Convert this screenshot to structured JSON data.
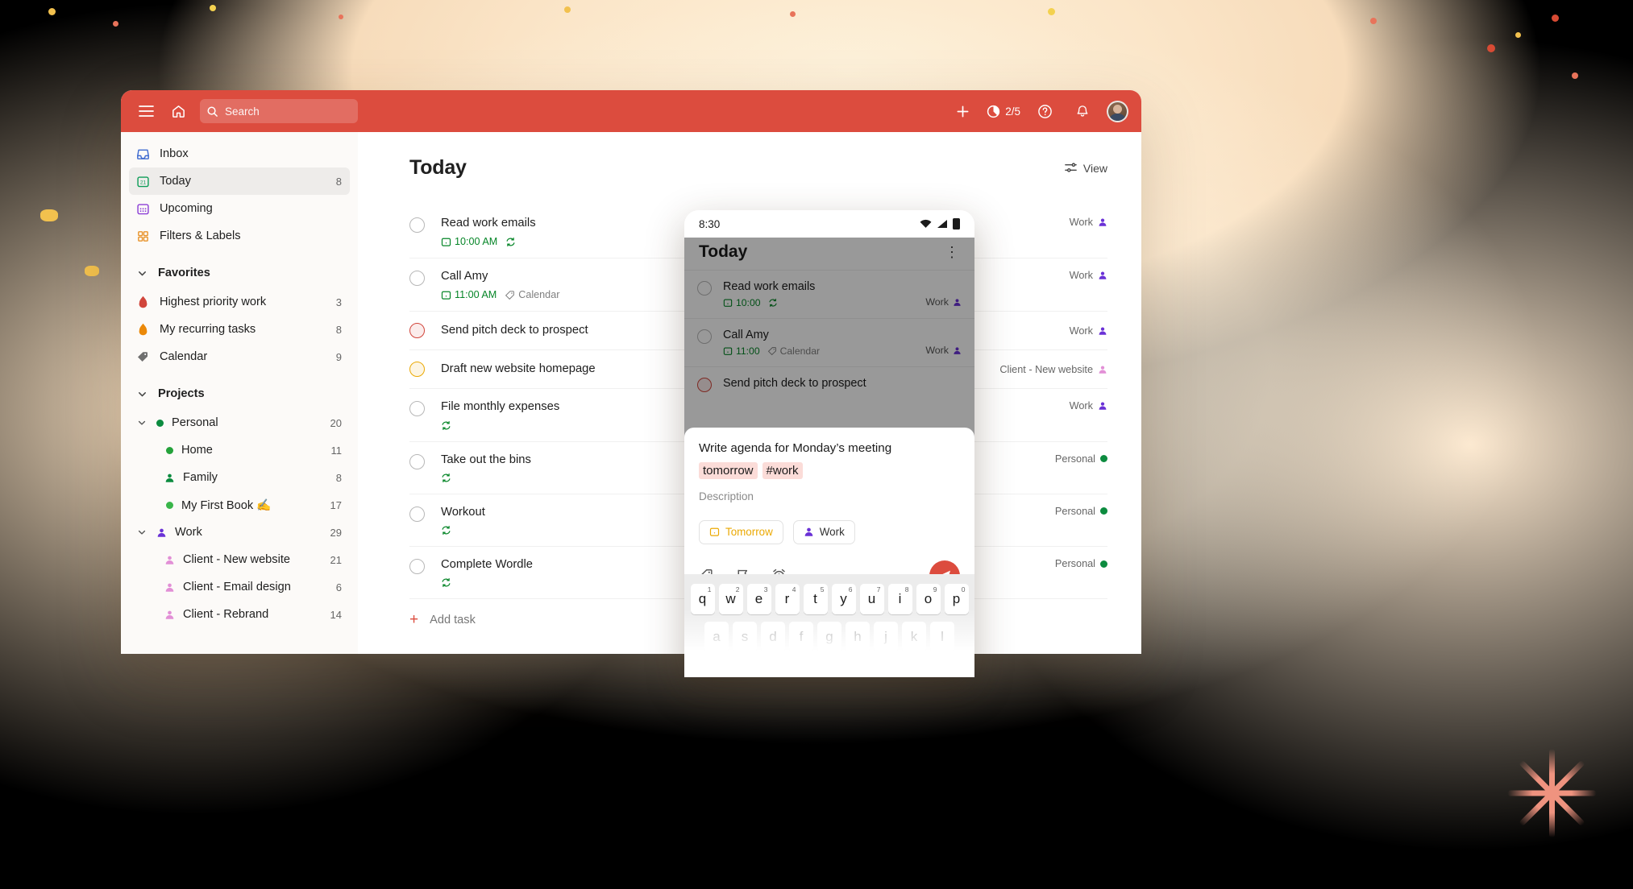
{
  "topbar": {
    "menu_icon": "hamburger-menu-icon",
    "home_icon": "home-icon",
    "search_icon": "search-icon",
    "search_placeholder": "Search",
    "add_icon": "plus-icon",
    "productivity_value": "2/5",
    "help_icon": "question-mark-icon",
    "notifications_icon": "bell-icon",
    "avatar": "user-avatar"
  },
  "sidebar": {
    "nav": [
      {
        "label": "Inbox",
        "icon": "inbox-icon",
        "count": "",
        "active": false
      },
      {
        "label": "Today",
        "icon": "calendar-today-icon",
        "count": "8",
        "active": true
      },
      {
        "label": "Upcoming",
        "icon": "calendar-month-icon",
        "count": "",
        "active": false
      },
      {
        "label": "Filters & Labels",
        "icon": "filters-labels-icon",
        "count": "",
        "active": false
      }
    ],
    "favorites": {
      "title": "Favorites",
      "items": [
        {
          "label": "Highest priority work",
          "icon": "flame-red-icon",
          "count": "3"
        },
        {
          "label": "My recurring tasks",
          "icon": "flame-orange-icon",
          "count": "8"
        },
        {
          "label": "Calendar",
          "icon": "tag-grey-icon",
          "count": "9"
        }
      ]
    },
    "projects": {
      "title": "Projects",
      "items": [
        {
          "label": "Personal",
          "icon": "dot-green",
          "count": "20",
          "level": 0,
          "expandable": true
        },
        {
          "label": "Home",
          "icon": "dot-lightgreen",
          "count": "11",
          "level": 1,
          "expandable": false
        },
        {
          "label": "Family",
          "icon": "person-green",
          "count": "8",
          "level": 1,
          "expandable": false
        },
        {
          "label": "My First Book ✍️",
          "icon": "dot-lightgreen",
          "count": "17",
          "level": 1,
          "expandable": false
        },
        {
          "label": "Work",
          "icon": "person-purple",
          "count": "29",
          "level": 0,
          "expandable": true
        },
        {
          "label": "Client - New website",
          "icon": "person-pink",
          "count": "21",
          "level": 1,
          "expandable": false
        },
        {
          "label": "Client - Email design",
          "icon": "person-pink",
          "count": "6",
          "level": 1,
          "expandable": false
        },
        {
          "label": "Client - Rebrand",
          "icon": "person-pink",
          "count": "14",
          "level": 1,
          "expandable": false
        }
      ]
    }
  },
  "main": {
    "title": "Today",
    "view_label": "View",
    "view_icon": "sliders-icon",
    "add_task_label": "Add task",
    "tasks": [
      {
        "title": "Read work emails",
        "date": "10:00 AM",
        "recurring": true,
        "label": "",
        "project": "Work",
        "project_dot": "person-purple",
        "priority": "none"
      },
      {
        "title": "Call Amy",
        "date": "11:00 AM",
        "recurring": false,
        "label": "Calendar",
        "project": "Work",
        "project_dot": "person-purple",
        "priority": "none"
      },
      {
        "title": "Send pitch deck to prospect",
        "date": "",
        "recurring": false,
        "label": "",
        "project": "Work",
        "project_dot": "person-purple",
        "priority": "p1"
      },
      {
        "title": "Draft new website homepage",
        "date": "",
        "recurring": false,
        "label": "",
        "project": "Client - New website",
        "project_dot": "person-pink",
        "priority": "p3"
      },
      {
        "title": "File monthly expenses",
        "date": "",
        "recurring": true,
        "label": "",
        "project": "Work",
        "project_dot": "person-purple",
        "priority": "none"
      },
      {
        "title": "Take out the bins",
        "date": "",
        "recurring": true,
        "label": "",
        "project": "Personal",
        "project_dot": "dot-green",
        "priority": "none"
      },
      {
        "title": "Workout",
        "date": "",
        "recurring": true,
        "label": "",
        "project": "Personal",
        "project_dot": "dot-green",
        "priority": "none"
      },
      {
        "title": "Complete Wordle",
        "date": "",
        "recurring": true,
        "label": "",
        "project": "Personal",
        "project_dot": "dot-green",
        "priority": "none"
      }
    ]
  },
  "phone": {
    "status_time": "8:30",
    "status_icons": [
      "wifi-icon",
      "cellular-signal-icon",
      "battery-icon"
    ],
    "title": "Today",
    "more_icon": "overflow-menu-icon",
    "tasks": [
      {
        "title": "Read work emails",
        "date": "10:00",
        "recurring": true,
        "label": "",
        "project": "Work",
        "priority": "none"
      },
      {
        "title": "Call Amy",
        "date": "11:00",
        "recurring": false,
        "label": "Calendar",
        "project": "Work",
        "priority": "none"
      },
      {
        "title": "Send pitch deck to prospect",
        "date": "",
        "recurring": false,
        "label": "",
        "project": "",
        "priority": "p1"
      }
    ],
    "compose": {
      "task_text": "Write agenda for Monday’s meeting",
      "chip_date": "tomorrow",
      "chip_project": "#work",
      "description_placeholder": "Description",
      "pill_date": "Tomorrow",
      "pill_date_icon": "calendar-icon",
      "pill_project": "Work",
      "pill_project_icon": "person-icon",
      "action_icons": [
        "label-tag-icon",
        "flag-priority-icon",
        "reminder-alarm-icon"
      ],
      "send_icon": "send-arrow-icon"
    },
    "keyboard": {
      "row1": [
        {
          "k": "q",
          "n": "1"
        },
        {
          "k": "w",
          "n": "2"
        },
        {
          "k": "e",
          "n": "3"
        },
        {
          "k": "r",
          "n": "4"
        },
        {
          "k": "t",
          "n": "5"
        },
        {
          "k": "y",
          "n": "6"
        },
        {
          "k": "u",
          "n": "7"
        },
        {
          "k": "i",
          "n": "8"
        },
        {
          "k": "o",
          "n": "9"
        },
        {
          "k": "p",
          "n": "0"
        }
      ],
      "row2": [
        {
          "k": "a"
        },
        {
          "k": "s"
        },
        {
          "k": "d"
        },
        {
          "k": "f"
        },
        {
          "k": "g"
        },
        {
          "k": "h"
        },
        {
          "k": "j"
        },
        {
          "k": "k"
        },
        {
          "k": "l"
        }
      ]
    }
  },
  "colors": {
    "brand_red": "#dc4c3e",
    "green": "#058527",
    "amber": "#eba904",
    "priority1": "#d1453b",
    "purple": "#6a31d6",
    "pink": "#e78ad0"
  }
}
